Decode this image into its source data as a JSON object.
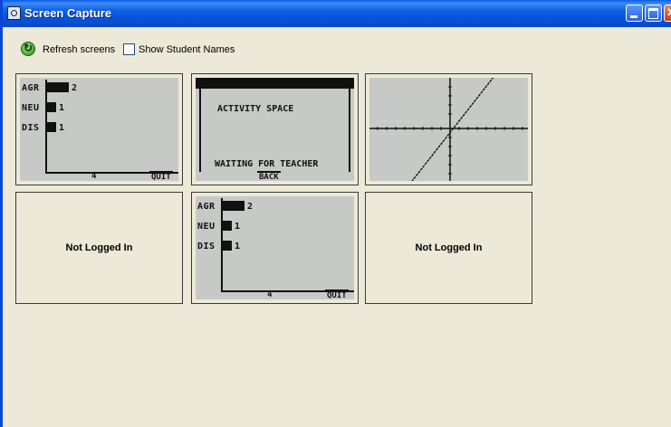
{
  "window": {
    "title": "Screen Capture",
    "minimize_icon": "minimize-icon",
    "maximize_icon": "maximize-icon",
    "close_icon": "close-icon"
  },
  "toolbar": {
    "refresh_label": "Refresh screens",
    "refresh_icon": "refresh-icon",
    "show_names_label": "Show Student Names",
    "show_names_checked": false
  },
  "tiles": [
    {
      "status": "screen",
      "screen_type": "bar-poll",
      "bars": [
        {
          "label": "AGR",
          "value": "2"
        },
        {
          "label": "NEU",
          "value": "1"
        },
        {
          "label": "DIS",
          "value": "1"
        }
      ],
      "axis_label": "4",
      "button": "QUIT"
    },
    {
      "status": "screen",
      "screen_type": "activity-space",
      "heading": "ACTIVITY SPACE",
      "message": "WAITING FOR TEACHER",
      "button": "BACK"
    },
    {
      "status": "screen",
      "screen_type": "graph"
    },
    {
      "status": "not-logged-in",
      "label": "Not Logged In"
    },
    {
      "status": "screen",
      "screen_type": "bar-poll",
      "bars": [
        {
          "label": "AGR",
          "value": "2"
        },
        {
          "label": "NEU",
          "value": "1"
        },
        {
          "label": "DIS",
          "value": "1"
        }
      ],
      "axis_label": "4",
      "button": "QUIT"
    },
    {
      "status": "not-logged-in",
      "label": "Not Logged In"
    }
  ],
  "colors": {
    "title_bar": "#0a5be8",
    "window_bg": "#ece9d8",
    "calc_screen": "#c7c9c6",
    "calc_ink": "#111111"
  }
}
